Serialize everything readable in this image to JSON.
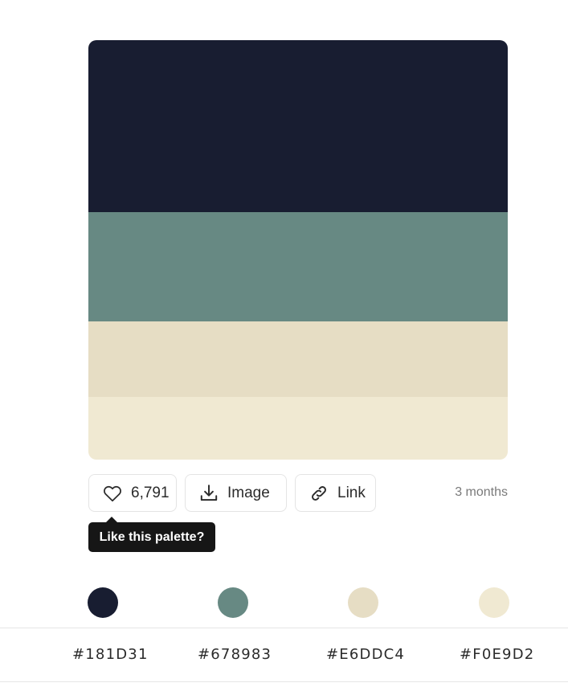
{
  "palette": {
    "colors": [
      {
        "hex": "#181D31",
        "label": "#181D31"
      },
      {
        "hex": "#678983",
        "label": "#678983"
      },
      {
        "hex": "#E6DDC4",
        "label": "#E6DDC4"
      },
      {
        "hex": "#F0E9D2",
        "label": "#F0E9D2"
      }
    ]
  },
  "actions": {
    "likes": "6,791",
    "like_icon": "heart-icon",
    "image_label": "Image",
    "image_icon": "download-icon",
    "link_label": "Link",
    "link_icon": "link-icon",
    "age": "3 months"
  },
  "tooltip": {
    "text": "Like this palette?"
  }
}
